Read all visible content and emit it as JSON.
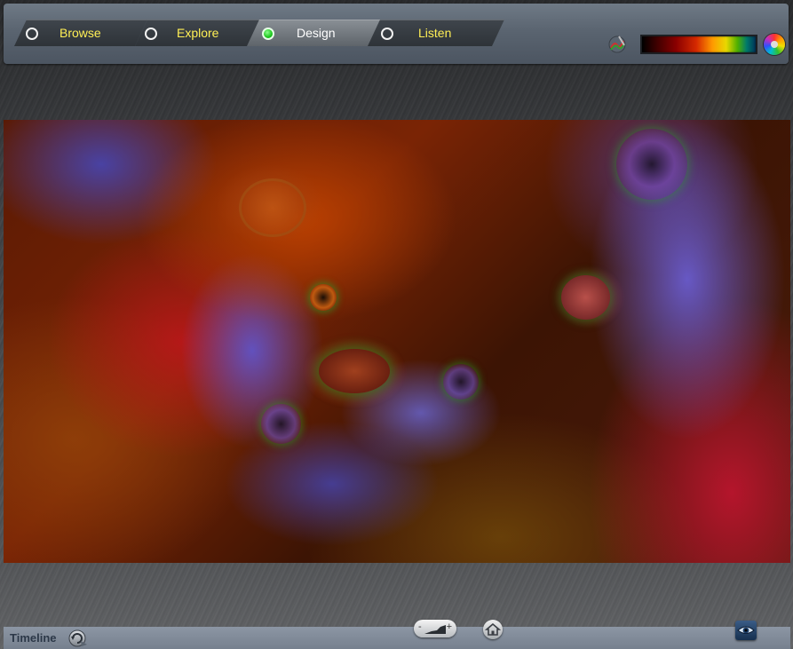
{
  "tabs": [
    {
      "label": "Browse",
      "active": false
    },
    {
      "label": "Explore",
      "active": false
    },
    {
      "label": "Design",
      "active": true
    },
    {
      "label": "Listen",
      "active": false
    }
  ],
  "toolbar_right": {
    "edit_icon": "paint-wand-icon",
    "palette": "color-gradient-bar",
    "wheel_icon": "color-wheel-icon"
  },
  "canvas": {
    "description_icon": "fractal-image"
  },
  "bottom": {
    "timeline_label": "Timeline",
    "timeline_icon": "timeline-refresh-icon",
    "zoom_icon": "zoom-slider-icon",
    "home_icon": "home-icon",
    "eye_icon": "eye-icon"
  },
  "colors": {
    "active_tab_label": "#ffffff",
    "inactive_tab_label": "#ffef55",
    "active_radio": "#1dc71d"
  }
}
